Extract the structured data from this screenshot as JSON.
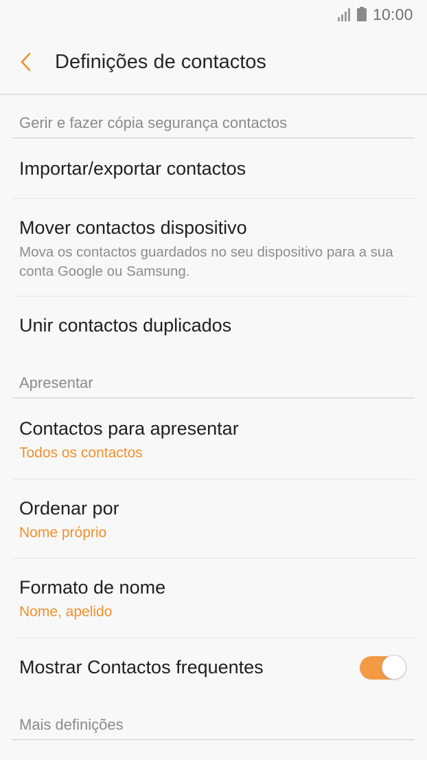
{
  "status_bar": {
    "time": "10:00"
  },
  "app_bar": {
    "title": "Definições de contactos",
    "back_icon": "chevron-left-icon",
    "accent_color": "#f0902e"
  },
  "sections": {
    "manage": {
      "header": "Gerir e fazer cópia segurança contactos",
      "items": {
        "import_export": {
          "title": "Importar/exportar contactos"
        },
        "move": {
          "title": "Mover contactos dispositivo",
          "subtitle": "Mova os contactos guardados no seu dispositivo para a sua conta Google ou Samsung."
        },
        "merge": {
          "title": "Unir contactos duplicados"
        }
      }
    },
    "display": {
      "header": "Apresentar",
      "items": {
        "contacts_to_display": {
          "title": "Contactos para apresentar",
          "value": "Todos os contactos"
        },
        "sort_by": {
          "title": "Ordenar por",
          "value": "Nome próprio"
        },
        "name_format": {
          "title": "Formato de nome",
          "value": "Nome, apelido"
        },
        "show_frequent": {
          "title": "Mostrar Contactos frequentes",
          "toggle_on": true
        }
      }
    },
    "more": {
      "header": "Mais definições"
    }
  }
}
